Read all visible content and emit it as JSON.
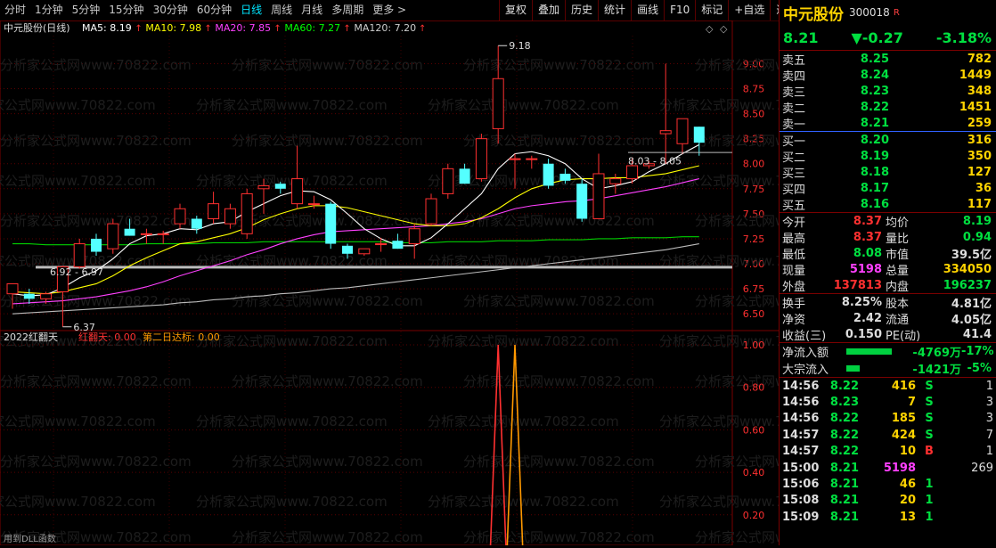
{
  "toolbar": {
    "periods": [
      "分时",
      "1分钟",
      "5分钟",
      "15分钟",
      "30分钟",
      "60分钟",
      "日线",
      "周线",
      "月线",
      "多周期",
      "更多 >"
    ],
    "active_period": "日线",
    "tools": [
      "复权",
      "叠加",
      "历史",
      "统计",
      "画线",
      "F10",
      "标记",
      "+自选",
      "返回"
    ]
  },
  "chart": {
    "title": "中元股份(日线)",
    "ma": [
      {
        "label": "MA5: 8.19",
        "color": "#ffffff"
      },
      {
        "label": "MA10: 7.98",
        "color": "#ffff00"
      },
      {
        "label": "MA20: 7.85",
        "color": "#ff40ff"
      },
      {
        "label": "MA60: 7.27",
        "color": "#00ff00"
      },
      {
        "label": "MA120: 7.20",
        "color": "#cccccc"
      }
    ],
    "price_axis": [
      "9.00",
      "8.75",
      "8.50",
      "8.25",
      "8.00",
      "7.75",
      "7.50",
      "7.25",
      "7.00",
      "6.75",
      "6.50"
    ],
    "annotations": {
      "high": "9.18",
      "low": "6.37",
      "range1": "6.92 - 6.97",
      "range2": "8.03 - 8.05"
    },
    "indicator": {
      "name": "2022红翻天",
      "line1": "红翻天: 0.00",
      "line2": "第二日达标: 0.00",
      "axis": [
        "1.00",
        "0.80",
        "0.60",
        "0.40",
        "0.20"
      ]
    },
    "watermark": "分析家公式网www.70822.com",
    "footer": "用到DLL函数"
  },
  "chart_data": {
    "type": "candlestick",
    "candles": [
      {
        "o": 6.7,
        "h": 6.8,
        "l": 6.55,
        "c": 6.8
      },
      {
        "o": 6.7,
        "h": 6.75,
        "l": 6.6,
        "c": 6.65
      },
      {
        "o": 6.65,
        "h": 6.72,
        "l": 6.6,
        "c": 6.7
      },
      {
        "o": 6.72,
        "h": 6.98,
        "l": 6.37,
        "c": 6.97
      },
      {
        "o": 6.97,
        "h": 7.25,
        "l": 6.95,
        "c": 7.2
      },
      {
        "o": 7.25,
        "h": 7.3,
        "l": 7.08,
        "c": 7.12
      },
      {
        "o": 7.15,
        "h": 7.45,
        "l": 7.1,
        "c": 7.4
      },
      {
        "o": 7.35,
        "h": 7.45,
        "l": 7.28,
        "c": 7.28
      },
      {
        "o": 7.3,
        "h": 7.35,
        "l": 7.2,
        "c": 7.3
      },
      {
        "o": 7.3,
        "h": 7.33,
        "l": 7.2,
        "c": 7.3
      },
      {
        "o": 7.4,
        "h": 7.6,
        "l": 7.35,
        "c": 7.55
      },
      {
        "o": 7.45,
        "h": 7.48,
        "l": 7.3,
        "c": 7.35
      },
      {
        "o": 7.45,
        "h": 7.72,
        "l": 7.4,
        "c": 7.6
      },
      {
        "o": 7.4,
        "h": 7.6,
        "l": 7.35,
        "c": 7.55
      },
      {
        "o": 7.3,
        "h": 7.75,
        "l": 7.25,
        "c": 7.7
      },
      {
        "o": 7.75,
        "h": 7.85,
        "l": 7.5,
        "c": 7.78
      },
      {
        "o": 7.8,
        "h": 7.82,
        "l": 7.7,
        "c": 7.75
      },
      {
        "o": 7.6,
        "h": 8.18,
        "l": 7.55,
        "c": 7.85
      },
      {
        "o": 7.6,
        "h": 7.68,
        "l": 7.55,
        "c": 7.6
      },
      {
        "o": 7.6,
        "h": 7.62,
        "l": 7.15,
        "c": 7.2
      },
      {
        "o": 7.18,
        "h": 7.2,
        "l": 7.05,
        "c": 7.1
      },
      {
        "o": 7.1,
        "h": 7.15,
        "l": 7.08,
        "c": 7.15
      },
      {
        "o": 7.2,
        "h": 7.26,
        "l": 7.12,
        "c": 7.2
      },
      {
        "o": 7.23,
        "h": 7.3,
        "l": 7.15,
        "c": 7.15
      },
      {
        "o": 7.2,
        "h": 7.4,
        "l": 7.05,
        "c": 7.35
      },
      {
        "o": 7.4,
        "h": 7.7,
        "l": 7.38,
        "c": 7.65
      },
      {
        "o": 7.7,
        "h": 8.0,
        "l": 7.65,
        "c": 7.95
      },
      {
        "o": 7.95,
        "h": 8.0,
        "l": 7.8,
        "c": 7.8
      },
      {
        "o": 7.85,
        "h": 8.3,
        "l": 7.82,
        "c": 8.25
      },
      {
        "o": 8.35,
        "h": 9.18,
        "l": 8.2,
        "c": 8.85
      },
      {
        "o": 8.05,
        "h": 8.1,
        "l": 7.75,
        "c": 8.05
      },
      {
        "o": 8.05,
        "h": 8.08,
        "l": 7.95,
        "c": 8.05
      },
      {
        "o": 8.0,
        "h": 8.05,
        "l": 7.75,
        "c": 7.78
      },
      {
        "o": 7.9,
        "h": 7.95,
        "l": 7.8,
        "c": 7.83
      },
      {
        "o": 7.8,
        "h": 7.85,
        "l": 7.42,
        "c": 7.45
      },
      {
        "o": 7.45,
        "h": 8.1,
        "l": 7.45,
        "c": 7.9
      },
      {
        "o": 7.8,
        "h": 7.9,
        "l": 7.7,
        "c": 7.85
      },
      {
        "o": 7.85,
        "h": 8.05,
        "l": 7.8,
        "c": 7.98
      },
      {
        "o": 7.98,
        "h": 8.03,
        "l": 7.95,
        "c": 8.0
      },
      {
        "o": 8.3,
        "h": 9.0,
        "l": 8.0,
        "c": 8.33
      },
      {
        "o": 8.2,
        "h": 8.45,
        "l": 8.1,
        "c": 8.45
      },
      {
        "o": 8.37,
        "h": 8.37,
        "l": 8.08,
        "c": 8.21
      }
    ],
    "ma5": [
      6.7,
      6.68,
      6.69,
      6.76,
      6.86,
      6.93,
      7.05,
      7.2,
      7.28,
      7.3,
      7.35,
      7.34,
      7.4,
      7.42,
      7.52,
      7.6,
      7.68,
      7.73,
      7.72,
      7.64,
      7.5,
      7.35,
      7.25,
      7.18,
      7.18,
      7.26,
      7.4,
      7.55,
      7.7,
      7.95,
      8.1,
      8.12,
      8.08,
      8.0,
      7.85,
      7.75,
      7.78,
      7.82,
      7.92,
      8.0,
      8.1,
      8.19
    ],
    "ma10": [
      6.72,
      6.71,
      6.7,
      6.72,
      6.76,
      6.8,
      6.88,
      6.98,
      7.06,
      7.13,
      7.2,
      7.22,
      7.26,
      7.3,
      7.36,
      7.44,
      7.5,
      7.55,
      7.58,
      7.58,
      7.56,
      7.52,
      7.48,
      7.44,
      7.4,
      7.38,
      7.38,
      7.4,
      7.46,
      7.55,
      7.66,
      7.75,
      7.8,
      7.84,
      7.85,
      7.85,
      7.86,
      7.86,
      7.88,
      7.9,
      7.94,
      7.98
    ],
    "ma20": [
      6.6,
      6.61,
      6.62,
      6.63,
      6.65,
      6.67,
      6.7,
      6.73,
      6.77,
      6.82,
      6.88,
      6.93,
      6.98,
      7.03,
      7.09,
      7.14,
      7.2,
      7.25,
      7.29,
      7.32,
      7.33,
      7.34,
      7.35,
      7.36,
      7.37,
      7.38,
      7.4,
      7.42,
      7.45,
      7.5,
      7.55,
      7.58,
      7.6,
      7.62,
      7.63,
      7.65,
      7.68,
      7.71,
      7.74,
      7.77,
      7.81,
      7.85
    ],
    "ma60": [
      7.2,
      7.2,
      7.19,
      7.19,
      7.19,
      7.19,
      7.19,
      7.19,
      7.2,
      7.2,
      7.2,
      7.2,
      7.21,
      7.21,
      7.21,
      7.22,
      7.22,
      7.22,
      7.22,
      7.22,
      7.22,
      7.22,
      7.22,
      7.21,
      7.21,
      7.21,
      7.22,
      7.22,
      7.22,
      7.23,
      7.23,
      7.23,
      7.24,
      7.24,
      7.24,
      7.25,
      7.25,
      7.26,
      7.26,
      7.26,
      7.27,
      7.27
    ],
    "ma120": [
      6.5,
      6.51,
      6.52,
      6.53,
      6.54,
      6.55,
      6.56,
      6.57,
      6.58,
      6.59,
      6.61,
      6.62,
      6.64,
      6.65,
      6.67,
      6.68,
      6.7,
      6.71,
      6.73,
      6.75,
      6.76,
      6.78,
      6.8,
      6.82,
      6.84,
      6.86,
      6.88,
      6.9,
      6.92,
      6.94,
      6.96,
      6.98,
      7.0,
      7.02,
      7.04,
      7.06,
      7.08,
      7.1,
      7.12,
      7.14,
      7.17,
      7.2
    ],
    "ylim": [
      6.37,
      9.18
    ],
    "indicator_spikes": [
      {
        "index": 29,
        "value": 1.0,
        "color": "#ff3030"
      },
      {
        "index": 30,
        "value": 1.0,
        "color": "#ff9900"
      }
    ]
  },
  "quote": {
    "name": "中元股份",
    "code": "300018",
    "badge": "R",
    "price": "8.21",
    "change": "▼-0.27",
    "pct": "-3.18%",
    "asks": [
      {
        "label": "卖五",
        "price": "8.25",
        "vol": "782"
      },
      {
        "label": "卖四",
        "price": "8.24",
        "vol": "1449"
      },
      {
        "label": "卖三",
        "price": "8.23",
        "vol": "348"
      },
      {
        "label": "卖二",
        "price": "8.22",
        "vol": "1451"
      },
      {
        "label": "卖一",
        "price": "8.21",
        "vol": "259"
      }
    ],
    "bids": [
      {
        "label": "买一",
        "price": "8.20",
        "vol": "316"
      },
      {
        "label": "买二",
        "price": "8.19",
        "vol": "350"
      },
      {
        "label": "买三",
        "price": "8.18",
        "vol": "127"
      },
      {
        "label": "买四",
        "price": "8.17",
        "vol": "36"
      },
      {
        "label": "买五",
        "price": "8.16",
        "vol": "117"
      }
    ],
    "stats": [
      {
        "a": "今开",
        "b": "8.37",
        "bc": "red",
        "c": "均价",
        "d": "8.19",
        "dc": "grn"
      },
      {
        "a": "最高",
        "b": "8.37",
        "bc": "red",
        "c": "量比",
        "d": "0.94",
        "dc": "grn"
      },
      {
        "a": "最低",
        "b": "8.08",
        "bc": "grn",
        "c": "市值",
        "d": "39.5亿",
        "dc": "wht"
      },
      {
        "a": "现量",
        "b": "5198",
        "bc": "mag",
        "c": "总量",
        "d": "334050",
        "dc": "ylw"
      },
      {
        "a": "外盘",
        "b": "137813",
        "bc": "red",
        "c": "内盘",
        "d": "196237",
        "dc": "grn"
      }
    ],
    "stats2": [
      {
        "a": "换手",
        "b": "8.25%",
        "bc": "wht",
        "c": "股本",
        "d": "4.81亿",
        "dc": "wht"
      },
      {
        "a": "净资",
        "b": "2.42",
        "bc": "wht",
        "c": "流通",
        "d": "4.05亿",
        "dc": "wht"
      },
      {
        "a": "收益(三)",
        "b": "0.150",
        "bc": "wht",
        "c": "PE(动)",
        "d": "41.4",
        "dc": "wht"
      }
    ],
    "flows": [
      {
        "label": "净流入额",
        "bar": 0.85,
        "value": "-4769万",
        "pct": "-17%"
      },
      {
        "label": "大宗流入",
        "bar": 0.25,
        "value": "-1421万",
        "pct": "-5%"
      }
    ],
    "ticks": [
      {
        "t": "14:56",
        "p": "8.22",
        "v": "416",
        "bs": "S",
        "bsc": "grn",
        "n": "1"
      },
      {
        "t": "14:56",
        "p": "8.23",
        "v": "7",
        "bs": "S",
        "bsc": "grn",
        "n": "3"
      },
      {
        "t": "14:56",
        "p": "8.22",
        "v": "185",
        "bs": "S",
        "bsc": "grn",
        "n": "3"
      },
      {
        "t": "14:57",
        "p": "8.22",
        "v": "424",
        "bs": "S",
        "bsc": "grn",
        "n": "7"
      },
      {
        "t": "14:57",
        "p": "8.22",
        "v": "10",
        "bs": "B",
        "bsc": "red",
        "n": "1"
      },
      {
        "t": "15:00",
        "p": "8.21",
        "v": "5198",
        "bs": "",
        "bsc": "grn",
        "n": "269"
      },
      {
        "t": "15:06",
        "p": "8.21",
        "v": "46",
        "bs": "1",
        "bsc": "grn",
        "n": ""
      },
      {
        "t": "15:08",
        "p": "8.21",
        "v": "20",
        "bs": "1",
        "bsc": "grn",
        "n": ""
      },
      {
        "t": "15:09",
        "p": "8.21",
        "v": "13",
        "bs": "1",
        "bsc": "grn",
        "n": ""
      }
    ]
  }
}
